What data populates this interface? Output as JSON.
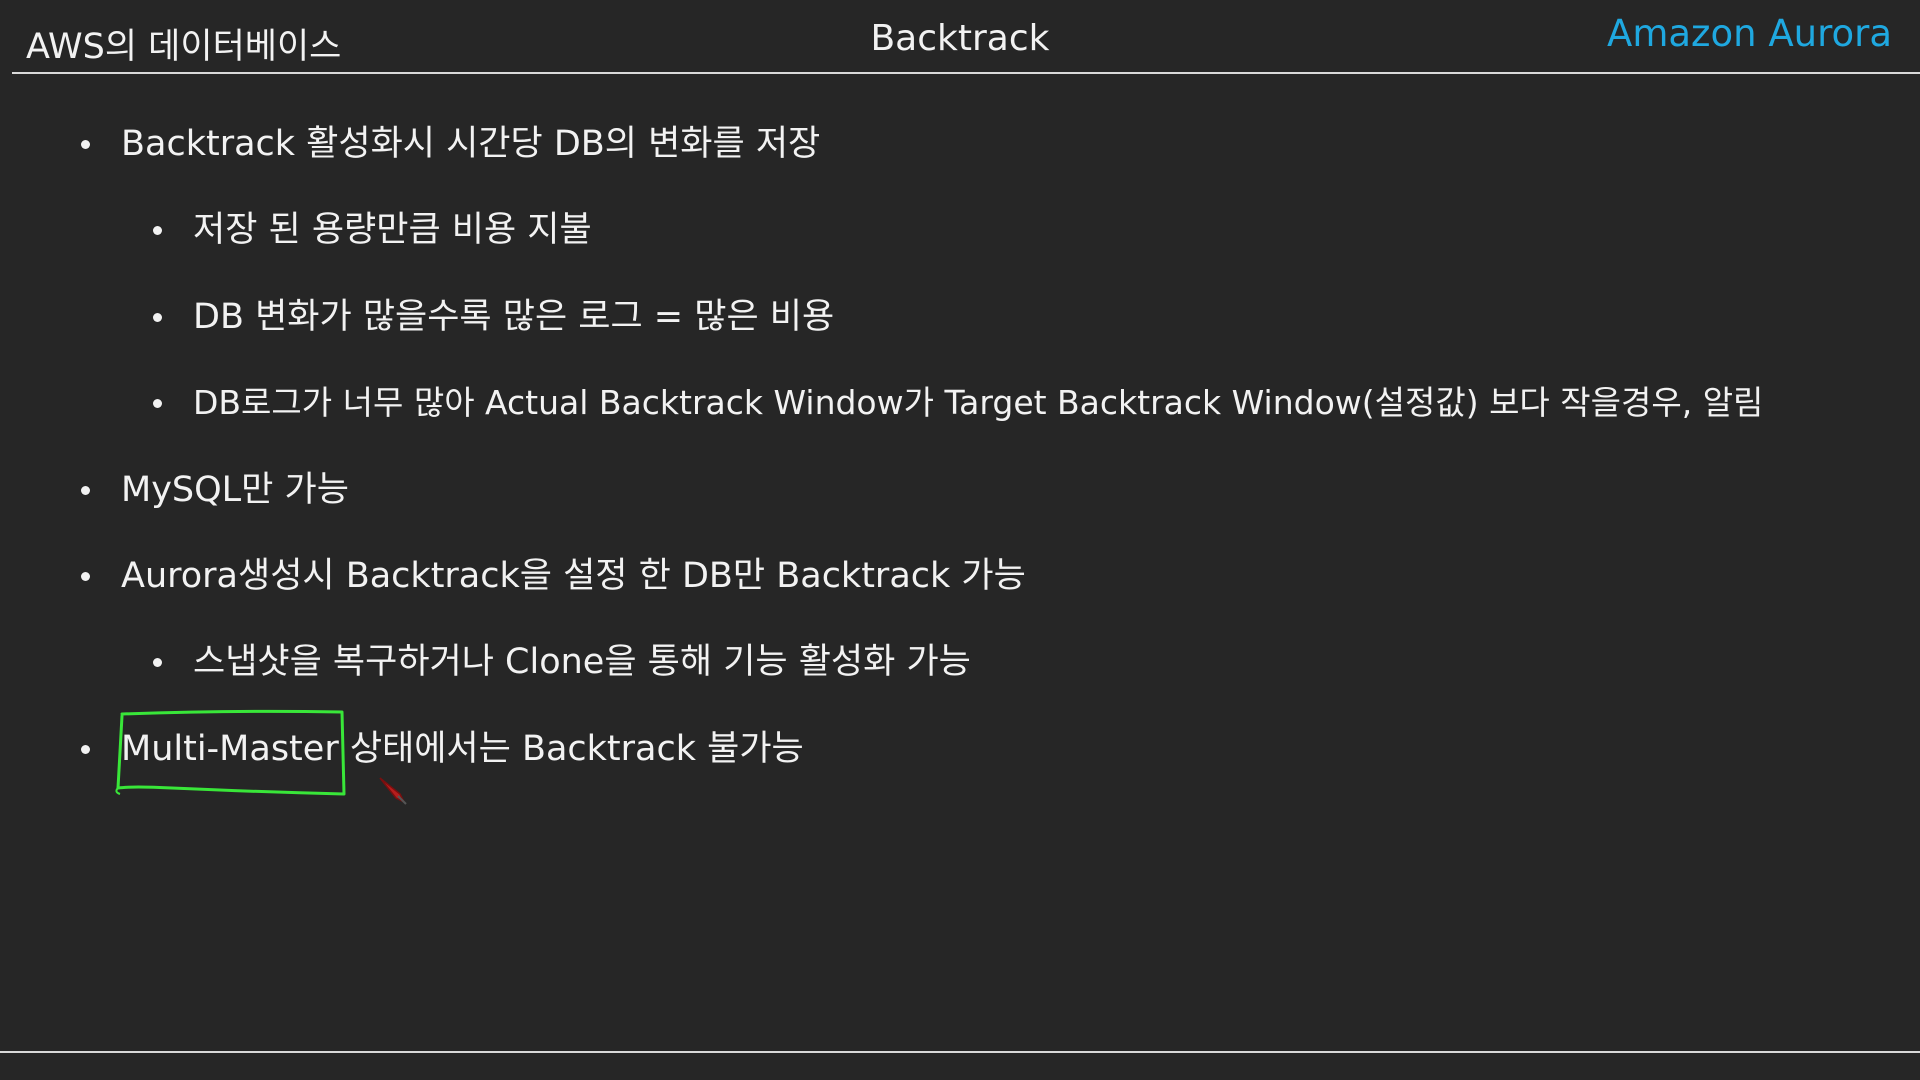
{
  "header": {
    "left_title": "AWS의 데이터베이스",
    "center_title": "Backtrack",
    "right_title": "Amazon Aurora"
  },
  "bullets": [
    {
      "level": 1,
      "text": "Backtrack 활성화시 시간당 DB의 변화를 저장"
    },
    {
      "level": 2,
      "text": "저장 된 용량만큼 비용 지불"
    },
    {
      "level": 2,
      "text": "DB 변화가 많을수록 많은 로그 = 많은 비용"
    },
    {
      "level": 2,
      "text": "DB로그가 너무 많아 Actual Backtrack Window가  Target Backtrack Window(설정값) 보다 작을경우, 알림"
    },
    {
      "level": 1,
      "text": "MySQL만 가능"
    },
    {
      "level": 1,
      "text": "Aurora생성시 Backtrack을 설정 한 DB만 Backtrack 가능"
    },
    {
      "level": 2,
      "text": "스냅샷을 복구하거나 Clone을 통해 기능 활성화 가능"
    },
    {
      "level": 1,
      "text": "Multi-Master 상태에서는 Backtrack 불가능"
    }
  ],
  "colors": {
    "background": "#262626",
    "text": "#f2f2f2",
    "accent": "#1fa8e0",
    "annotation": "#39e639"
  }
}
